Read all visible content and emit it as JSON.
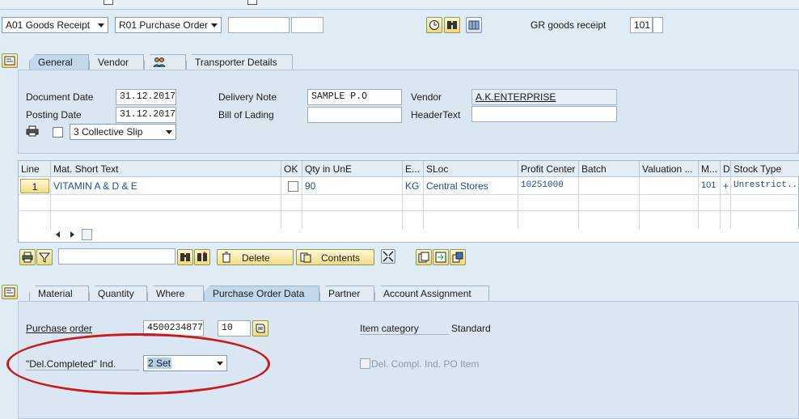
{
  "toolbar": {
    "action_select": "A01 Goods Receipt",
    "reference_select": "R01 Purchase Order",
    "reference_input_1": "",
    "reference_input_2": "",
    "movement_label": "GR goods receipt",
    "movement_type": "101"
  },
  "header_tabs": [
    "General",
    "Vendor",
    "",
    "Transporter Details"
  ],
  "header": {
    "document_date_label": "Document Date",
    "document_date": "31.12.2017",
    "posting_date_label": "Posting Date",
    "posting_date": "31.12.2017",
    "delivery_note_label": "Delivery Note",
    "delivery_note": "SAMPLE P.O",
    "bill_of_lading_label": "Bill of Lading",
    "bill_of_lading": "",
    "vendor_label": "Vendor",
    "vendor": "A.K.ENTERPRISE",
    "header_text_label": "HeaderText",
    "header_text": "",
    "print_version": "3 Collective Slip"
  },
  "items_table": {
    "columns": [
      "Line",
      "Mat. Short Text",
      "OK",
      "Qty in UnE",
      "E...",
      "SLoc",
      "Profit Center",
      "Batch",
      "Valuation ...",
      "M...",
      "D",
      "Stock Type"
    ],
    "rows": [
      {
        "line": "1",
        "mat_short_text": "VITAMIN A & D & E",
        "qty": "90",
        "unit": "KG",
        "sloc": "Central Stores",
        "profit_center": "10251000",
        "batch": "",
        "valuation": "",
        "movement": "101",
        "debit": "+",
        "stock_type": "Unrestrict..."
      }
    ]
  },
  "item_toolbar": {
    "delete_label": "Delete",
    "contents_label": "Contents",
    "search_value": ""
  },
  "detail_tabs": [
    "Material",
    "Quantity",
    "Where",
    "Purchase Order Data",
    "Partner",
    "Account Assignment"
  ],
  "detail": {
    "purchase_order_label": "Purchase order",
    "purchase_order": "4500234877",
    "po_item": "10",
    "item_category_label": "Item category",
    "item_category": "Standard",
    "del_completed_label": "\"Del.Completed\" Ind.",
    "del_completed_value": "2 Set",
    "del_compl_po_item_label": "Del. Compl. Ind. PO Item"
  },
  "colors": {
    "background": "#dfebf5",
    "panel": "#dae7f2",
    "link_blue": "#1a4d9a",
    "annotation_red": "#cc1a1a",
    "button_yellow": "#f3dc86"
  }
}
